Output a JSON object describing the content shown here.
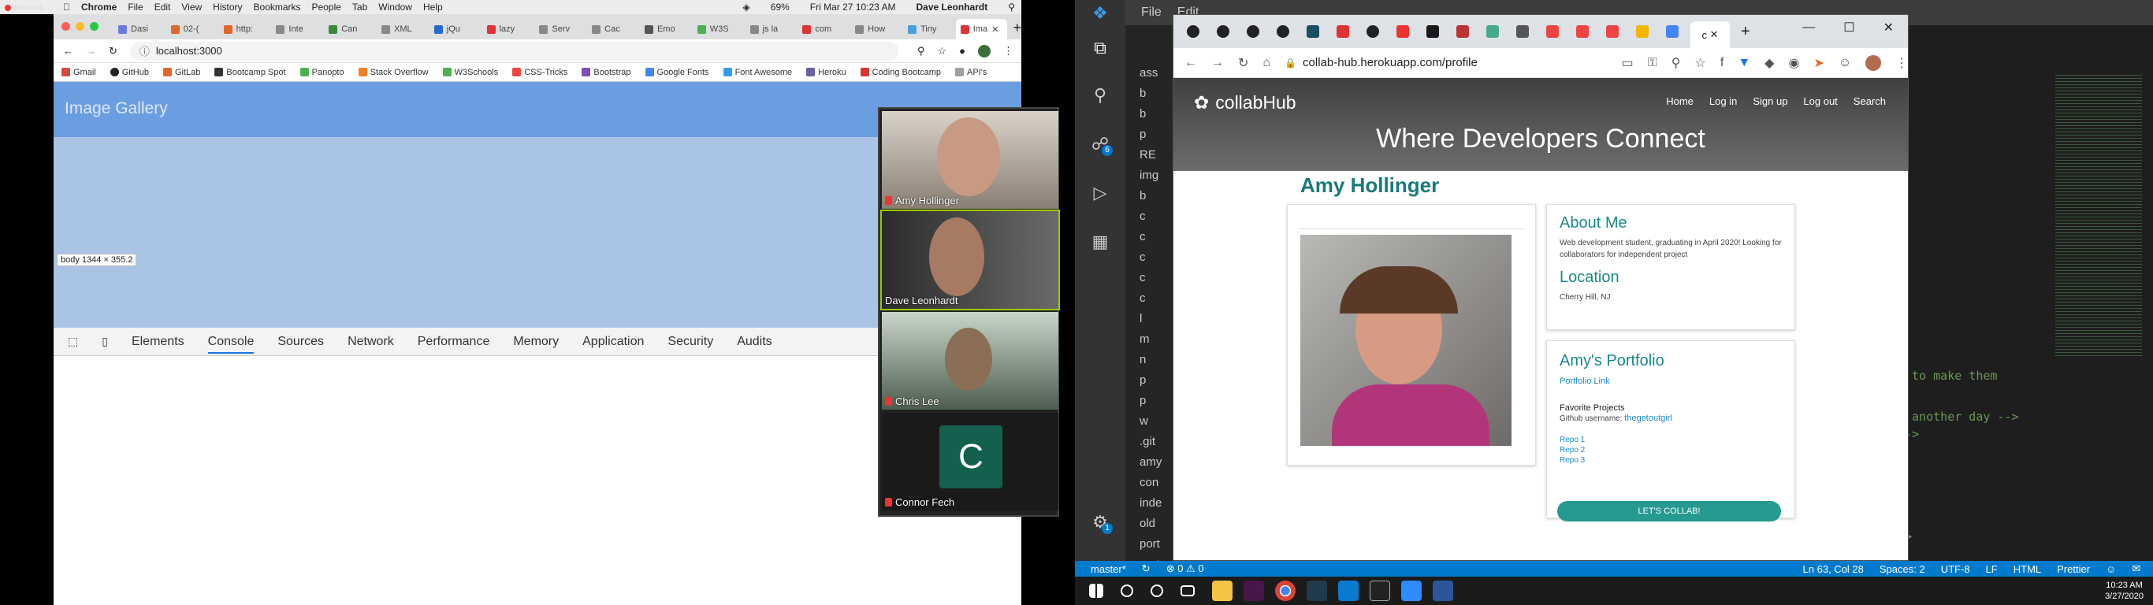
{
  "mac_menubar": {
    "record_label": "Record",
    "app": "Chrome",
    "items": [
      "File",
      "Edit",
      "View",
      "History",
      "Bookmarks",
      "People",
      "Tab",
      "Window",
      "Help"
    ],
    "battery": "69%",
    "clock": "Fri Mar 27 10:23 AM",
    "user": "Dave Leonhardt"
  },
  "mac_chrome": {
    "tabs": [
      "Dasi",
      "02-(",
      "http:",
      "Inte",
      "Can",
      "XML",
      "jQu",
      "lazy",
      "Serv",
      "Cac",
      "Emo",
      "W3S",
      "js la",
      "com",
      "How",
      "Tiny",
      "Ima"
    ],
    "url": "localhost:3000",
    "bookmarks": [
      "Gmail",
      "GitHub",
      "GitLab",
      "Bootcamp Spot",
      "Panopto",
      "Stack Overflow",
      "W3Schools",
      "CSS-Tricks",
      "Bootstrap",
      "Google Fonts",
      "Font Awesome",
      "Heroku",
      "Coding Bootcamp",
      "API's"
    ],
    "page_title": "Image Gallery",
    "tooltip": "body  1344 × 355.2",
    "devtools_tabs": [
      "Elements",
      "Console",
      "Sources",
      "Network",
      "Performance",
      "Memory",
      "Application",
      "Security",
      "Audits"
    ],
    "devtools_selected": "Console"
  },
  "zoom": {
    "participants": [
      "Amy Hollinger",
      "Dave Leonhardt",
      "Chris Lee",
      "Connor Fech"
    ],
    "avatar_letter": "C"
  },
  "vscode": {
    "menu": [
      "File",
      "Edit"
    ],
    "explorer": [
      "ass",
      "b",
      "b",
      "p",
      "RE",
      "img",
      "b",
      "c",
      "c",
      "c",
      "c",
      "c",
      "l",
      "m",
      "n",
      "p",
      "p",
      "w",
      ".git",
      "amy",
      "con",
      "inde",
      "old",
      "port",
      "port"
    ],
    "code_lines": [
      "n to make them",
      "r another day -->",
      "-->",
      "\">"
    ],
    "badge_source": "6",
    "badge_settings": "1",
    "status": {
      "branch": "master*",
      "problems": "⊗ 0 ⚠ 0",
      "position": "Ln 63, Col 28",
      "spaces": "Spaces: 2",
      "encoding": "UTF-8",
      "eol": "LF",
      "lang": "HTML",
      "formatter": "Prettier"
    }
  },
  "win_chrome": {
    "url": "collab-hub.herokuapp.com/profile",
    "active_tab_label": "c",
    "window_controls": [
      "—",
      "☐",
      "✕"
    ]
  },
  "site": {
    "logo": "collabHub",
    "nav": [
      "Home",
      "Log in",
      "Sign up",
      "Log out",
      "Search"
    ],
    "tagline": "Where Developers Connect",
    "profile_name": "Amy Hollinger",
    "about_title": "About Me",
    "about_text": "Web development student, graduating in April 2020! Looking for collaborators for independent project",
    "location_title": "Location",
    "location_text": "Cherry Hill, NJ",
    "portfolio_title": "Amy's Portfolio",
    "portfolio_link": "Portfolio Link",
    "projects_title": "Favorite Projects",
    "github_label": "Github username:",
    "github_user": "thegetoutgirl",
    "repos": [
      "Repo 1",
      "Repo 2",
      "Repo 3"
    ],
    "button": "LET'S COLLAB!"
  },
  "taskbar": {
    "time": "10:23 AM",
    "date": "3/27/2020"
  }
}
